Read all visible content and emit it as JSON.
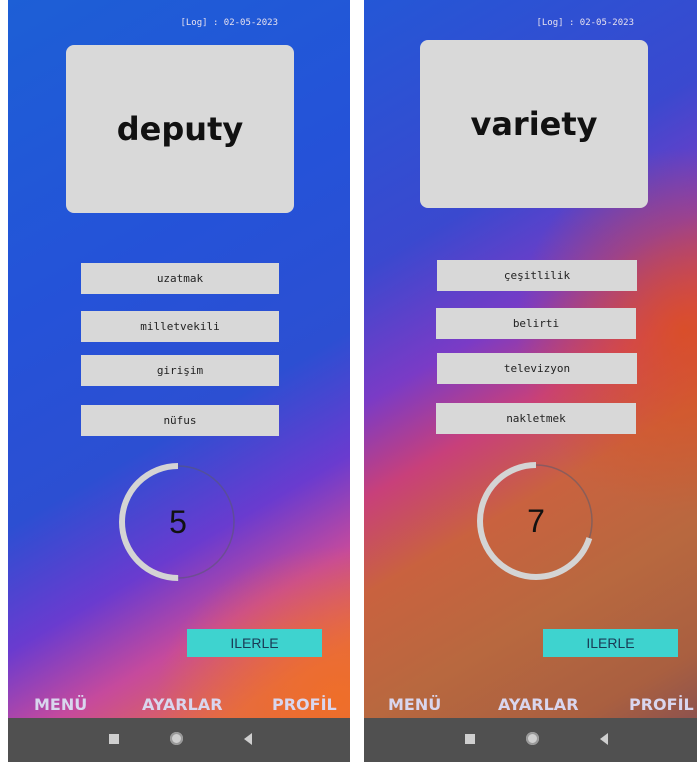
{
  "screens": [
    {
      "log_text": "[Log] : 02-05-2023",
      "word": "deputy",
      "options": [
        "uzatmak",
        "milletvekili",
        "girişim",
        "nüfus"
      ],
      "timer_value": "5",
      "timer_progress": 0.5,
      "next_label": "ILERLE",
      "tabs": [
        "MENÜ",
        "AYARLAR",
        "PROFİL"
      ]
    },
    {
      "log_text": "[Log] : 02-05-2023",
      "word": "variety",
      "options": [
        "çeşitlilik",
        "belirti",
        "televizyon",
        "nakletmek"
      ],
      "timer_value": "7",
      "timer_progress": 0.7,
      "next_label": "ILERLE",
      "tabs": [
        "MENÜ",
        "AYARLAR",
        "PROFİL"
      ]
    }
  ],
  "icons": {
    "recent": "square-icon",
    "home": "circle-icon",
    "back": "triangle-left-icon"
  }
}
